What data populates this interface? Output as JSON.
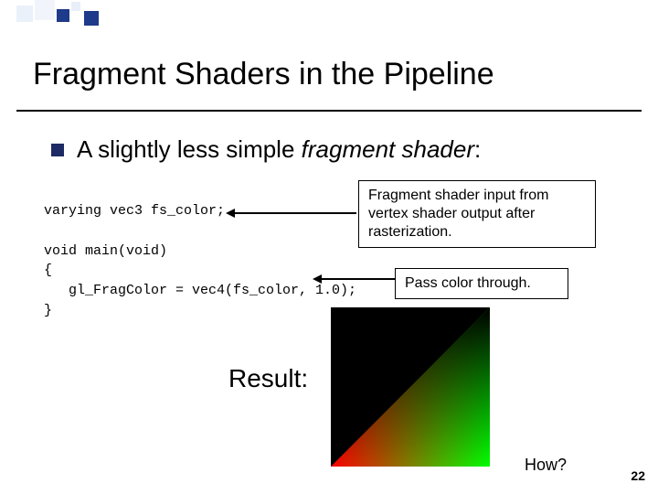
{
  "title": "Fragment Shaders in the Pipeline",
  "subline_prefix": "A slightly less simple ",
  "subline_emph": "fragment shader",
  "subline_suffix": ":",
  "code": "varying vec3 fs_color;\n\nvoid main(void)\n{\n   gl_FragColor = vec4(fs_color, 1.0);\n}",
  "callout1": "Fragment shader input from vertex shader output after rasterization.",
  "callout2": "Pass color through.",
  "result_label": "Result:",
  "how_label": "How?",
  "page_number": "22"
}
